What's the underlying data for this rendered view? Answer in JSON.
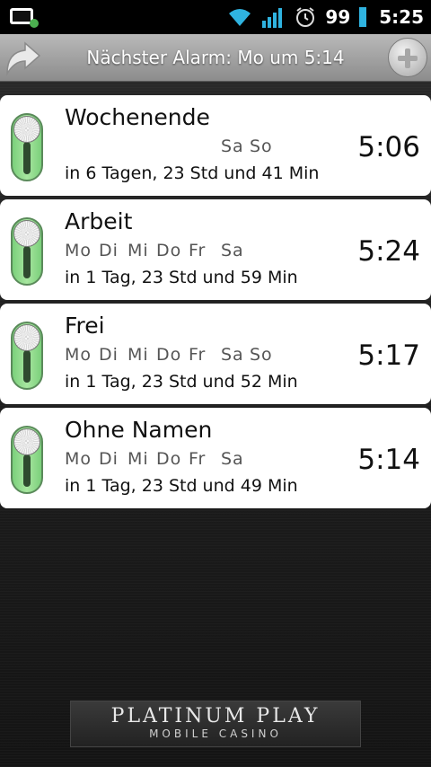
{
  "status_bar": {
    "battery_level": "99",
    "time": "5:25"
  },
  "header": {
    "title": "Nächster Alarm: Mo um 5:14"
  },
  "alarms": [
    {
      "name": "Wochenende",
      "days": [
        "",
        "",
        "",
        "",
        "",
        "Sa",
        "So"
      ],
      "remaining": "in 6 Tagen, 23 Std und 41 Min",
      "time": "5:06",
      "enabled": true
    },
    {
      "name": "Arbeit",
      "days": [
        "Mo",
        "Di",
        "Mi",
        "Do",
        "Fr",
        "Sa",
        ""
      ],
      "remaining": "in 1 Tag, 23 Std und 59 Min",
      "time": "5:24",
      "enabled": true
    },
    {
      "name": "Frei",
      "days": [
        "Mo",
        "Di",
        "Mi",
        "Do",
        "Fr",
        "Sa",
        "So"
      ],
      "remaining": "in 1 Tag, 23 Std und 52 Min",
      "time": "5:17",
      "enabled": true
    },
    {
      "name": "Ohne Namen",
      "days": [
        "Mo",
        "Di",
        "Mi",
        "Do",
        "Fr",
        "Sa",
        ""
      ],
      "remaining": "in 1 Tag, 23 Std und 49 Min",
      "time": "5:14",
      "enabled": true
    }
  ],
  "ad": {
    "line1": "PLATINUM PLAY",
    "line2": "MOBILE CASINO"
  },
  "colors": {
    "toggle_on": "#8fdc8a",
    "card": "#ffffff",
    "header_bar": "#a5a5a5",
    "wifi": "#2fb3e0",
    "signal": "#2fb3e0"
  }
}
